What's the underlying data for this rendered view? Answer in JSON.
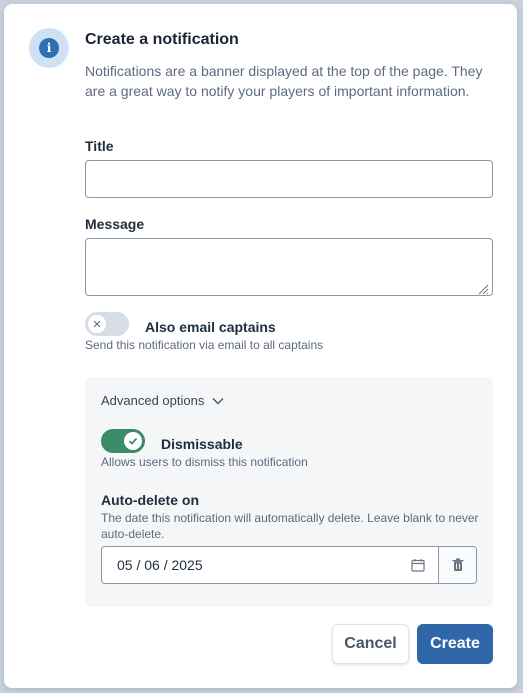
{
  "dialog": {
    "title": "Create a notification",
    "description": "Notifications are a banner displayed at the top of the page. They are a great way to notify your players of important information.",
    "info_icon": "info-icon"
  },
  "form": {
    "title_label": "Title",
    "title_value": "",
    "message_label": "Message",
    "message_value": "",
    "email_captains": {
      "label": "Also email captains",
      "hint": "Send this notification via email to all captains",
      "enabled": false
    }
  },
  "advanced": {
    "header": "Advanced options",
    "dismissable": {
      "label": "Dismissable",
      "hint": "Allows users to dismiss this notification",
      "enabled": true
    },
    "auto_delete": {
      "label": "Auto-delete on",
      "hint": "The date this notification will automatically delete. Leave blank to never auto-delete.",
      "date": "05 / 06 / 2025"
    }
  },
  "actions": {
    "cancel_label": "Cancel",
    "create_label": "Create"
  },
  "colors": {
    "primary": "#2f67a8",
    "toggle_on": "#3b8a6a",
    "info_badge": "#cfe1f5"
  }
}
